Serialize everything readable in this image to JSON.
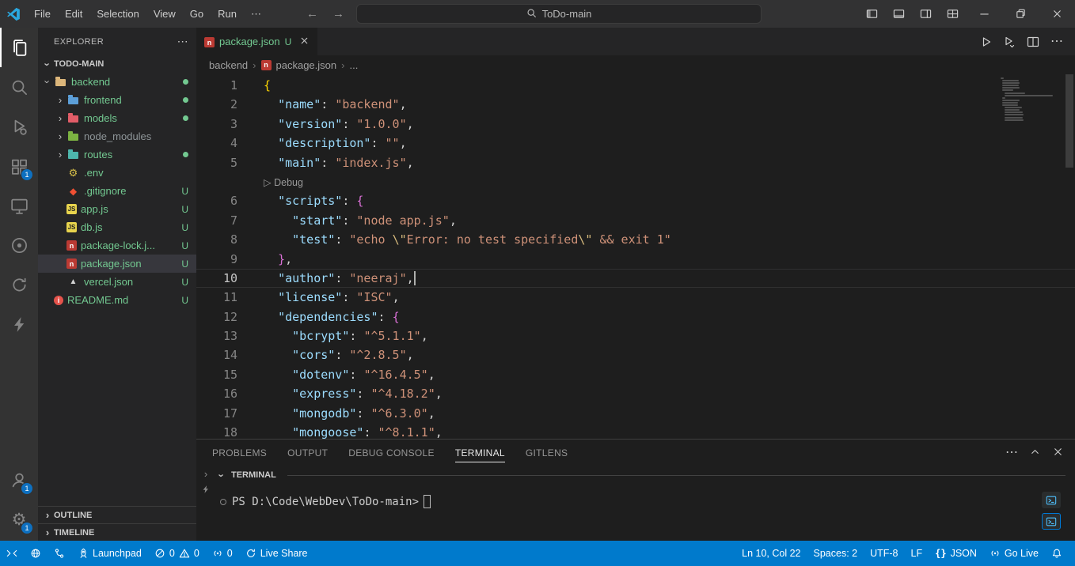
{
  "titlebar": {
    "menu": [
      "File",
      "Edit",
      "Selection",
      "View",
      "Go",
      "Run",
      "⋯"
    ],
    "search_label": "ToDo-main",
    "window_controls": [
      "layout-sidebar-left",
      "layout-panel",
      "layout-sidebar-right",
      "layout-customize",
      "minimize",
      "restore",
      "close"
    ]
  },
  "activity_bar": {
    "top": [
      {
        "icon": "files",
        "active": true
      },
      {
        "icon": "search"
      },
      {
        "icon": "run-debug"
      },
      {
        "icon": "extensions",
        "badge": "1"
      },
      {
        "icon": "remote-explorer"
      },
      {
        "icon": "gitlens"
      },
      {
        "icon": "live-share"
      },
      {
        "icon": "thunder-client"
      }
    ],
    "bottom": [
      {
        "icon": "account",
        "badge": "1"
      },
      {
        "icon": "settings",
        "badge": "1"
      }
    ]
  },
  "explorer": {
    "header": "EXPLORER",
    "project": "TODO-MAIN",
    "items": [
      {
        "label": "backend",
        "kind": "folder",
        "depth": 0,
        "expanded": true,
        "icon": "folder",
        "color": "#dcb67a",
        "status": "dot"
      },
      {
        "label": "frontend",
        "kind": "folder",
        "depth": 1,
        "icon": "folder",
        "color": "#5c9fd8",
        "status": "dot"
      },
      {
        "label": "models",
        "kind": "folder",
        "depth": 1,
        "icon": "folder",
        "color": "#e25d68",
        "status": "dot"
      },
      {
        "label": "node_modules",
        "kind": "folder",
        "depth": 1,
        "icon": "folder",
        "color": "#7cb342",
        "muted": true,
        "status": ""
      },
      {
        "label": "routes",
        "kind": "folder",
        "depth": 1,
        "icon": "folder",
        "color": "#4db6ac",
        "status": "dot"
      },
      {
        "label": ".env",
        "kind": "file",
        "depth": 1,
        "icon": "gear",
        "color": "#d8c049",
        "status": ""
      },
      {
        "label": ".gitignore",
        "kind": "file",
        "depth": 1,
        "icon": "git",
        "color": "#f05033",
        "status": "U"
      },
      {
        "label": "app.js",
        "kind": "file",
        "depth": 1,
        "icon": "js",
        "color": "#e8d44d",
        "status": "U"
      },
      {
        "label": "db.js",
        "kind": "file",
        "depth": 1,
        "icon": "js",
        "color": "#e8d44d",
        "status": "U"
      },
      {
        "label": "package-lock.j...",
        "kind": "file",
        "depth": 1,
        "icon": "npm",
        "color": "#bb3a33",
        "status": "U"
      },
      {
        "label": "package.json",
        "kind": "file",
        "depth": 1,
        "icon": "npm",
        "color": "#bb3a33",
        "status": "U",
        "selected": true
      },
      {
        "label": "vercel.json",
        "kind": "file",
        "depth": 1,
        "icon": "vercel",
        "color": "#d4d4d4",
        "status": "U"
      },
      {
        "label": "README.md",
        "kind": "file",
        "depth": 0,
        "icon": "info",
        "color": "#e5534b",
        "status": "U"
      }
    ],
    "bottom_sections": [
      "OUTLINE",
      "TIMELINE"
    ]
  },
  "editor": {
    "tab": {
      "icon": "npm",
      "label": "package.json",
      "git_badge": "U"
    },
    "actions": [
      "run",
      "run-or-debug",
      "split-editor",
      "more"
    ],
    "breadcrumb": {
      "items": [
        "backend",
        "package.json",
        "..."
      ],
      "icon_at": 1
    },
    "cursor": {
      "line": 10,
      "col": 22
    }
  },
  "code": {
    "lines": [
      {
        "n": "1",
        "tokens": [
          {
            "t": "b1",
            "v": "{"
          }
        ]
      },
      {
        "n": "2",
        "tokens": [
          {
            "t": "p",
            "v": "  "
          },
          {
            "t": "k",
            "v": "\"name\""
          },
          {
            "t": "p",
            "v": ": "
          },
          {
            "t": "s",
            "v": "\"backend\""
          },
          {
            "t": "p",
            "v": ","
          }
        ]
      },
      {
        "n": "3",
        "tokens": [
          {
            "t": "p",
            "v": "  "
          },
          {
            "t": "k",
            "v": "\"version\""
          },
          {
            "t": "p",
            "v": ": "
          },
          {
            "t": "s",
            "v": "\"1.0.0\""
          },
          {
            "t": "p",
            "v": ","
          }
        ]
      },
      {
        "n": "4",
        "tokens": [
          {
            "t": "p",
            "v": "  "
          },
          {
            "t": "k",
            "v": "\"description\""
          },
          {
            "t": "p",
            "v": ": "
          },
          {
            "t": "s",
            "v": "\"\""
          },
          {
            "t": "p",
            "v": ","
          }
        ]
      },
      {
        "n": "5",
        "tokens": [
          {
            "t": "p",
            "v": "  "
          },
          {
            "t": "k",
            "v": "\"main\""
          },
          {
            "t": "p",
            "v": ": "
          },
          {
            "t": "s",
            "v": "\"index.js\""
          },
          {
            "t": "p",
            "v": ","
          }
        ]
      },
      {
        "codelens": true,
        "tokens": [
          {
            "t": "cl",
            "v": "▷ Debug"
          }
        ]
      },
      {
        "n": "6",
        "tokens": [
          {
            "t": "p",
            "v": "  "
          },
          {
            "t": "k",
            "v": "\"scripts\""
          },
          {
            "t": "p",
            "v": ": "
          },
          {
            "t": "b2",
            "v": "{"
          }
        ]
      },
      {
        "n": "7",
        "tokens": [
          {
            "t": "p",
            "v": "    "
          },
          {
            "t": "k",
            "v": "\"start\""
          },
          {
            "t": "p",
            "v": ": "
          },
          {
            "t": "s",
            "v": "\"node app.js\""
          },
          {
            "t": "p",
            "v": ","
          }
        ]
      },
      {
        "n": "8",
        "tokens": [
          {
            "t": "p",
            "v": "    "
          },
          {
            "t": "k",
            "v": "\"test\""
          },
          {
            "t": "p",
            "v": ": "
          },
          {
            "t": "s",
            "v": "\"echo "
          },
          {
            "t": "e",
            "v": "\\\""
          },
          {
            "t": "s",
            "v": "Error: no test specified"
          },
          {
            "t": "e",
            "v": "\\\""
          },
          {
            "t": "s",
            "v": " && exit 1\""
          }
        ]
      },
      {
        "n": "9",
        "tokens": [
          {
            "t": "p",
            "v": "  "
          },
          {
            "t": "b2",
            "v": "}"
          },
          {
            "t": "p",
            "v": ","
          }
        ]
      },
      {
        "n": "10",
        "active": true,
        "cursor_after": true,
        "tokens": [
          {
            "t": "p",
            "v": "  "
          },
          {
            "t": "k",
            "v": "\"author\""
          },
          {
            "t": "p",
            "v": ": "
          },
          {
            "t": "s",
            "v": "\"neeraj\""
          },
          {
            "t": "p",
            "v": ","
          }
        ]
      },
      {
        "n": "11",
        "tokens": [
          {
            "t": "p",
            "v": "  "
          },
          {
            "t": "k",
            "v": "\"license\""
          },
          {
            "t": "p",
            "v": ": "
          },
          {
            "t": "s",
            "v": "\"ISC\""
          },
          {
            "t": "p",
            "v": ","
          }
        ]
      },
      {
        "n": "12",
        "tokens": [
          {
            "t": "p",
            "v": "  "
          },
          {
            "t": "k",
            "v": "\"dependencies\""
          },
          {
            "t": "p",
            "v": ": "
          },
          {
            "t": "b2",
            "v": "{"
          }
        ]
      },
      {
        "n": "13",
        "tokens": [
          {
            "t": "p",
            "v": "    "
          },
          {
            "t": "k",
            "v": "\"bcrypt\""
          },
          {
            "t": "p",
            "v": ": "
          },
          {
            "t": "s",
            "v": "\"^5.1.1\""
          },
          {
            "t": "p",
            "v": ","
          }
        ]
      },
      {
        "n": "14",
        "tokens": [
          {
            "t": "p",
            "v": "    "
          },
          {
            "t": "k",
            "v": "\"cors\""
          },
          {
            "t": "p",
            "v": ": "
          },
          {
            "t": "s",
            "v": "\"^2.8.5\""
          },
          {
            "t": "p",
            "v": ","
          }
        ]
      },
      {
        "n": "15",
        "tokens": [
          {
            "t": "p",
            "v": "    "
          },
          {
            "t": "k",
            "v": "\"dotenv\""
          },
          {
            "t": "p",
            "v": ": "
          },
          {
            "t": "s",
            "v": "\"^16.4.5\""
          },
          {
            "t": "p",
            "v": ","
          }
        ]
      },
      {
        "n": "16",
        "tokens": [
          {
            "t": "p",
            "v": "    "
          },
          {
            "t": "k",
            "v": "\"express\""
          },
          {
            "t": "p",
            "v": ": "
          },
          {
            "t": "s",
            "v": "\"^4.18.2\""
          },
          {
            "t": "p",
            "v": ","
          }
        ]
      },
      {
        "n": "17",
        "tokens": [
          {
            "t": "p",
            "v": "    "
          },
          {
            "t": "k",
            "v": "\"mongodb\""
          },
          {
            "t": "p",
            "v": ": "
          },
          {
            "t": "s",
            "v": "\"^6.3.0\""
          },
          {
            "t": "p",
            "v": ","
          }
        ]
      },
      {
        "n": "18",
        "tokens": [
          {
            "t": "p",
            "v": "    "
          },
          {
            "t": "k",
            "v": "\"mongoose\""
          },
          {
            "t": "p",
            "v": ": "
          },
          {
            "t": "s",
            "v": "\"^8.1.1\""
          },
          {
            "t": "p",
            "v": ","
          }
        ]
      }
    ]
  },
  "panel": {
    "tabs": [
      {
        "label": "PROBLEMS"
      },
      {
        "label": "OUTPUT"
      },
      {
        "label": "DEBUG CONSOLE"
      },
      {
        "label": "TERMINAL",
        "active": true
      },
      {
        "label": "GITLENS"
      }
    ],
    "actions": [
      "more",
      "chevron-up",
      "close"
    ],
    "section_label": "TERMINAL",
    "terminal": {
      "prompt": "PS D:\\Code\\WebDev\\ToDo-main>",
      "side_icons": [
        "powershell",
        "powershell"
      ]
    }
  },
  "status_bar": {
    "left": [
      {
        "icon": "remote",
        "name": "remote-window"
      },
      {
        "icon": "globe",
        "name": "go-live-server"
      },
      {
        "icon": "graph",
        "name": "commit-graph"
      },
      {
        "icon": "rocket",
        "label": "Launchpad",
        "name": "launchpad"
      },
      {
        "name": "problems",
        "parts": [
          {
            "icon": "error"
          },
          {
            "label": "0"
          },
          {
            "icon": "warning"
          },
          {
            "label": "0"
          }
        ]
      },
      {
        "icon": "broadcast",
        "label": "0",
        "name": "ports"
      },
      {
        "icon": "live-share",
        "label": "Live Share",
        "name": "live-share"
      }
    ],
    "right": [
      {
        "label": "Ln 10, Col 22",
        "name": "cursor-position"
      },
      {
        "label": "Spaces: 2",
        "name": "indentation"
      },
      {
        "label": "UTF-8",
        "name": "encoding"
      },
      {
        "label": "LF",
        "name": "eol"
      },
      {
        "icon": "braces",
        "label": "JSON",
        "name": "language-mode"
      },
      {
        "icon": "broadcast",
        "label": "Go Live",
        "name": "go-live"
      },
      {
        "icon": "bell",
        "name": "notifications"
      }
    ]
  }
}
